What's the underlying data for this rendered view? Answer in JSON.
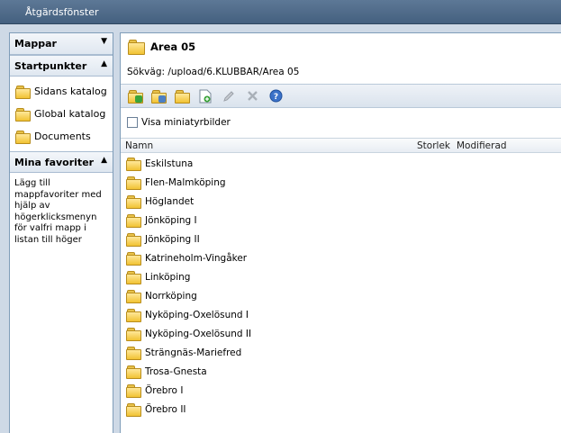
{
  "window": {
    "title": "Åtgärdsfönster"
  },
  "left": {
    "mappar": {
      "title": "Mappar"
    },
    "startpunkter": {
      "title": "Startpunkter",
      "items": [
        {
          "label": "Sidans katalog"
        },
        {
          "label": "Global katalog"
        },
        {
          "label": "Documents"
        }
      ]
    },
    "favoriter": {
      "title": "Mina favoriter",
      "text": "Lägg till mappfavoriter med hjälp av högerklicksmenyn för valfri mapp i listan till höger"
    }
  },
  "right": {
    "folder_title": "Area 05",
    "path": "Sökväg: /upload/6.KLUBBAR/Area 05",
    "thumbnails_label": "Visa miniatyrbilder",
    "columns": {
      "name": "Namn",
      "size": "Storlek",
      "modified": "Modifierad"
    },
    "rows": [
      {
        "name": "Eskilstuna"
      },
      {
        "name": "Flen-Malmköping"
      },
      {
        "name": "Höglandet"
      },
      {
        "name": "Jönköping I"
      },
      {
        "name": "Jönköping II"
      },
      {
        "name": "Katrineholm-Vingåker"
      },
      {
        "name": "Linköping"
      },
      {
        "name": "Norrköping"
      },
      {
        "name": "Nyköping-Oxelösund I"
      },
      {
        "name": "Nyköping-Oxelösund II"
      },
      {
        "name": "Strängnäs-Mariefred"
      },
      {
        "name": "Trosa-Gnesta"
      },
      {
        "name": "Örebro I"
      },
      {
        "name": "Örebro II"
      }
    ]
  },
  "colors": {
    "accent": "#5d7896",
    "folder": "#f1c232",
    "panel_border": "#7f9db9"
  }
}
